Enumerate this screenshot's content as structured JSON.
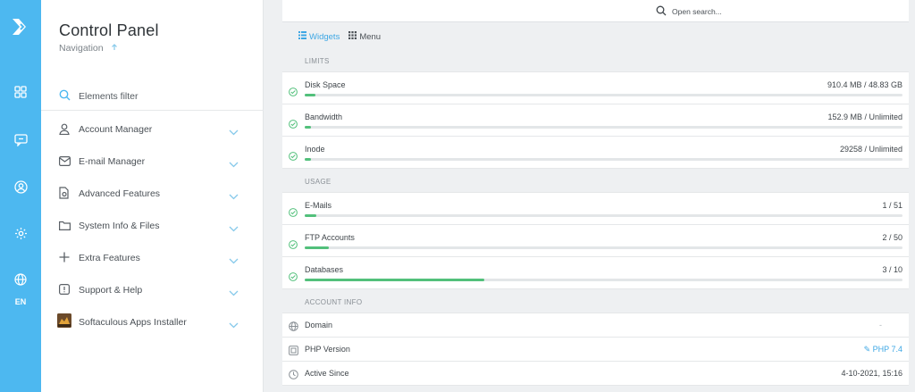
{
  "rail": {
    "lang": "EN",
    "icons": [
      "arrow-logo-icon",
      "dashboard-grid-icon",
      "chat-bubble-icon",
      "user-circle-icon",
      "settings-gear-icon",
      "globe-icon"
    ]
  },
  "sidebar": {
    "title": "Control Panel",
    "subtitle": "Navigation",
    "filter_label": "Elements filter",
    "items": [
      {
        "label": "Account Manager",
        "icon": "user-icon"
      },
      {
        "label": "E-mail Manager",
        "icon": "envelope-icon"
      },
      {
        "label": "Advanced Features",
        "icon": "document-gear-icon"
      },
      {
        "label": "System Info & Files",
        "icon": "folder-icon"
      },
      {
        "label": "Extra Features",
        "icon": "plus-icon"
      },
      {
        "label": "Support & Help",
        "icon": "alert-box-icon"
      },
      {
        "label": "Softaculous Apps Installer",
        "icon": "softaculous-icon"
      }
    ]
  },
  "search": {
    "placeholder": "Open search..."
  },
  "tabs": {
    "widgets": "Widgets",
    "menu": "Menu"
  },
  "limits": {
    "heading": "LIMITS",
    "rows": [
      {
        "label": "Disk Space",
        "value": "910.4 MB / 48.83 GB",
        "percent": 1.8
      },
      {
        "label": "Bandwidth",
        "value": "152.9 MB / Unlimited",
        "percent": 1
      },
      {
        "label": "Inode",
        "value": "29258 / Unlimited",
        "percent": 1
      }
    ]
  },
  "usage": {
    "heading": "USAGE",
    "rows": [
      {
        "label": "E-Mails",
        "value": "1 / 51",
        "percent": 2
      },
      {
        "label": "FTP Accounts",
        "value": "2 / 50",
        "percent": 4
      },
      {
        "label": "Databases",
        "value": "3 / 10",
        "percent": 30
      }
    ]
  },
  "account_info": {
    "heading": "ACCOUNT INFO",
    "domain_label": "Domain",
    "domain_value": "-",
    "php_label": "PHP Version",
    "php_value": "PHP 7.4",
    "active_label": "Active Since",
    "active_value": "4-10-2021, 15:16"
  },
  "colors": {
    "accent": "#4db8f0",
    "bar_fill": "#52c07b",
    "check": "#52c07b"
  }
}
